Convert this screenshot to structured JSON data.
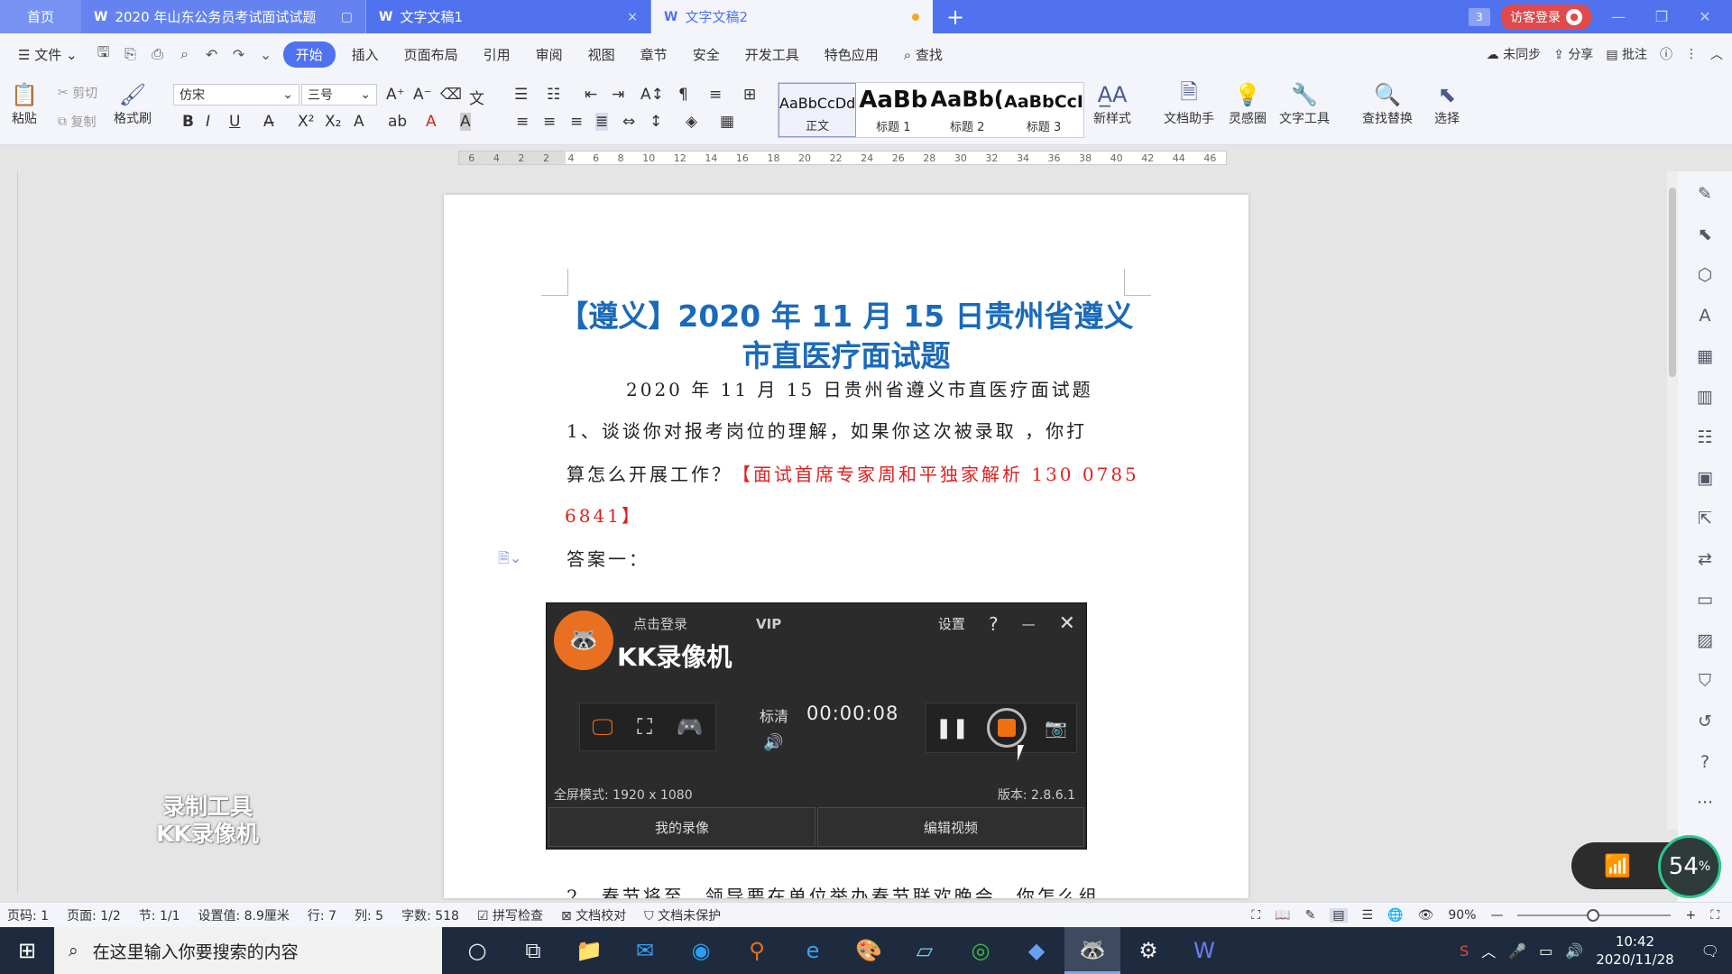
{
  "titlebar": {
    "home_tab": "首页",
    "tabs": [
      {
        "label": "2020 年山东公务员考试面试试题",
        "icon": "wps-writer-icon"
      },
      {
        "label": "文字文稿1",
        "icon": "wps-writer-icon"
      },
      {
        "label": "文字文稿2",
        "icon": "wps-writer-icon",
        "modified": true
      }
    ],
    "badge": "3",
    "visitor_login": "访客登录"
  },
  "menubar": {
    "file": "文件",
    "items": [
      "开始",
      "插入",
      "页面布局",
      "引用",
      "审阅",
      "视图",
      "章节",
      "安全",
      "开发工具",
      "特色应用"
    ],
    "active": "开始",
    "search": "查找",
    "sync": "未同步",
    "share": "分享",
    "comment": "批注"
  },
  "ribbon": {
    "paste": "粘贴",
    "cut": "剪切",
    "copy": "复制",
    "format_painter": "格式刷",
    "font_name": "仿宋",
    "font_size": "三号",
    "styles": [
      {
        "sample": "AaBbCcDd",
        "label": "正文"
      },
      {
        "sample": "AaBb",
        "label": "标题 1"
      },
      {
        "sample": "AaBb(",
        "label": "标题 2"
      },
      {
        "sample": "AaBbCcI",
        "label": "标题 3"
      }
    ],
    "new_style": "新样式",
    "doc_assistant": "文档助手",
    "inspiration": "灵感圈",
    "text_tools": "文字工具",
    "find_replace": "查找替换",
    "select": "选择"
  },
  "ruler": {
    "ticks": [
      "6",
      "4",
      "2",
      "2",
      "4",
      "6",
      "8",
      "10",
      "12",
      "14",
      "16",
      "18",
      "20",
      "22",
      "24",
      "26",
      "28",
      "30",
      "32",
      "34",
      "36",
      "38",
      "40",
      "42",
      "44",
      "46"
    ]
  },
  "document": {
    "title_line1": "【遵义】2020 年 11 月 15 日贵州省遵义",
    "title_line2": "市直医疗面试题",
    "subtitle": "2020 年 11 月 15 日贵州省遵义市直医疗面试题",
    "q1_line1": "1、谈谈你对报考岗位的理解，如果你这次被录取  ，你打",
    "q1_line2_black": "算怎么开展工作？",
    "q1_line2_red": "【面试首席专家周和平独家解析 130 0785",
    "q1_line3_red": "6841】",
    "answer1": "答案一：",
    "q2_partial": "2、春节将至，领导要在单位举办春节联欢晚会，你怎么组"
  },
  "recorder": {
    "login": "点击登录",
    "vip": "VIP",
    "name": "KK录像机",
    "settings": "设置",
    "help": "?",
    "quality": "标清",
    "timer": "00:00:08",
    "mode": "全屏模式: 1920 x 1080",
    "version": "版本: 2.8.6.1",
    "my_recordings": "我的录像",
    "edit_video": "编辑视频"
  },
  "watermark": {
    "line1": "录制工具",
    "line2": "KK录像机"
  },
  "network": {
    "percent": "54",
    "unit": "%"
  },
  "statusbar": {
    "page_code": "页码: 1",
    "page": "页面: 1/2",
    "section": "节: 1/1",
    "setting": "设置值: 8.9厘米",
    "row": "行: 7",
    "col": "列: 5",
    "words": "字数: 518",
    "spell": "拼写检查",
    "proof": "文档校对",
    "protect": "文档未保护",
    "zoom": "90%",
    "zoom_fraction": 0.45
  },
  "taskbar": {
    "search_placeholder": "在这里输入你要搜索的内容",
    "time": "10:42",
    "date": "2020/11/28"
  }
}
